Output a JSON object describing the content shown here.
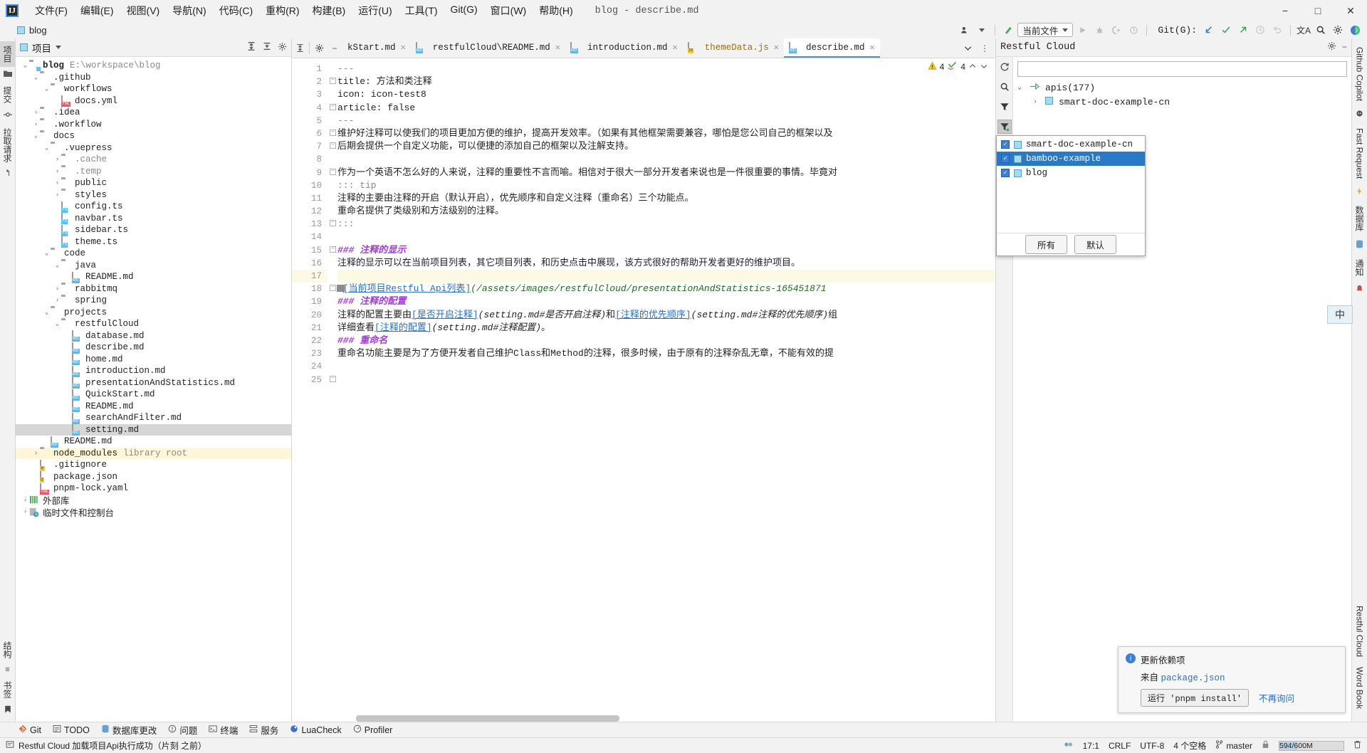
{
  "menubar": {
    "logo": "IJ",
    "items": [
      "文件(F)",
      "编辑(E)",
      "视图(V)",
      "导航(N)",
      "代码(C)",
      "重构(R)",
      "构建(B)",
      "运行(U)",
      "工具(T)",
      "Git(G)",
      "窗口(W)",
      "帮助(H)"
    ],
    "window_title": "blog - describe.md",
    "minimize": "−",
    "maximize": "□",
    "close": "✕"
  },
  "navrow": {
    "breadcrumb": "blog",
    "run_config": "当前文件",
    "git_label": "Git(G):",
    "icons": {
      "vcs_user": "vcs-user-icon",
      "update": "update-icon",
      "run": "▶",
      "debug": "debug-icon",
      "coverage": "coverage-icon",
      "profile": "profile-icon",
      "git_pull": "↙",
      "git_commit": "✓",
      "git_push": "↗",
      "git_history": "◷",
      "git_rollback": "↺",
      "translate": "文A",
      "search": "search-icon",
      "settings": "gear-icon",
      "ai": "ai-icon"
    }
  },
  "left_rail": {
    "items": [
      "项目",
      "提交",
      "拉取请求"
    ],
    "bottom": [
      "结构",
      "书签"
    ]
  },
  "project_panel": {
    "title": "项目",
    "tree": [
      {
        "depth": 0,
        "arrow": "v",
        "icon": "folder-module",
        "label": "blog",
        "bold": true,
        "suffix": "E:\\workspace\\blog"
      },
      {
        "depth": 1,
        "arrow": "v",
        "icon": "folder",
        "label": ".github"
      },
      {
        "depth": 2,
        "arrow": "v",
        "icon": "folder",
        "label": "workflows"
      },
      {
        "depth": 3,
        "arrow": "",
        "icon": "yml",
        "label": "docs.yml"
      },
      {
        "depth": 1,
        "arrow": ">",
        "icon": "folder",
        "label": ".idea"
      },
      {
        "depth": 1,
        "arrow": ">",
        "icon": "folder",
        "label": ".workflow"
      },
      {
        "depth": 1,
        "arrow": "v",
        "icon": "folder",
        "label": "docs"
      },
      {
        "depth": 2,
        "arrow": "v",
        "icon": "folder",
        "label": ".vuepress"
      },
      {
        "depth": 3,
        "arrow": ">",
        "icon": "folder",
        "label": ".cache",
        "dim": true
      },
      {
        "depth": 3,
        "arrow": ">",
        "icon": "folder",
        "label": ".temp",
        "dim": true
      },
      {
        "depth": 3,
        "arrow": ">",
        "icon": "folder",
        "label": "public"
      },
      {
        "depth": 3,
        "arrow": ">",
        "icon": "folder",
        "label": "styles"
      },
      {
        "depth": 3,
        "arrow": "",
        "icon": "ts",
        "label": "config.ts"
      },
      {
        "depth": 3,
        "arrow": "",
        "icon": "ts",
        "label": "navbar.ts"
      },
      {
        "depth": 3,
        "arrow": "",
        "icon": "ts",
        "label": "sidebar.ts"
      },
      {
        "depth": 3,
        "arrow": "",
        "icon": "ts",
        "label": "theme.ts"
      },
      {
        "depth": 2,
        "arrow": "v",
        "icon": "folder",
        "label": "code"
      },
      {
        "depth": 3,
        "arrow": "v",
        "icon": "folder",
        "label": "java"
      },
      {
        "depth": 4,
        "arrow": "",
        "icon": "md",
        "label": "README.md"
      },
      {
        "depth": 3,
        "arrow": ">",
        "icon": "folder",
        "label": "rabbitmq"
      },
      {
        "depth": 3,
        "arrow": ">",
        "icon": "folder",
        "label": "spring"
      },
      {
        "depth": 2,
        "arrow": "v",
        "icon": "folder",
        "label": "projects"
      },
      {
        "depth": 3,
        "arrow": "v",
        "icon": "folder",
        "label": "restfulCloud"
      },
      {
        "depth": 4,
        "arrow": "",
        "icon": "md",
        "label": "database.md"
      },
      {
        "depth": 4,
        "arrow": "",
        "icon": "md",
        "label": "describe.md"
      },
      {
        "depth": 4,
        "arrow": "",
        "icon": "md",
        "label": "home.md"
      },
      {
        "depth": 4,
        "arrow": "",
        "icon": "md",
        "label": "introduction.md"
      },
      {
        "depth": 4,
        "arrow": "",
        "icon": "md",
        "label": "presentationAndStatistics.md"
      },
      {
        "depth": 4,
        "arrow": "",
        "icon": "md",
        "label": "QuickStart.md"
      },
      {
        "depth": 4,
        "arrow": "",
        "icon": "md",
        "label": "README.md"
      },
      {
        "depth": 4,
        "arrow": "",
        "icon": "md",
        "label": "searchAndFilter.md"
      },
      {
        "depth": 4,
        "arrow": "",
        "icon": "md",
        "label": "setting.md",
        "selected": true
      },
      {
        "depth": 2,
        "arrow": "",
        "icon": "md",
        "label": "README.md"
      },
      {
        "depth": 1,
        "arrow": ">",
        "icon": "folder",
        "label": "node_modules",
        "suffix": "library root",
        "highlight": true
      },
      {
        "depth": 1,
        "arrow": "",
        "icon": "gitignore",
        "label": ".gitignore"
      },
      {
        "depth": 1,
        "arrow": "",
        "icon": "json",
        "label": "package.json"
      },
      {
        "depth": 1,
        "arrow": "",
        "icon": "yml",
        "label": "pnpm-lock.yaml"
      },
      {
        "depth": 0,
        "arrow": ">",
        "icon": "lib",
        "label": "外部库"
      },
      {
        "depth": 0,
        "arrow": ">",
        "icon": "scratch",
        "label": "临时文件和控制台"
      }
    ]
  },
  "editor": {
    "tabs": [
      {
        "label": "kStart.md",
        "icon": "md",
        "clipped": true
      },
      {
        "label": "restfulCloud\\README.md",
        "icon": "md"
      },
      {
        "label": "introduction.md",
        "icon": "md"
      },
      {
        "label": "themeData.js",
        "icon": "js",
        "orange": true
      },
      {
        "label": "describe.md",
        "icon": "md",
        "active": true
      }
    ],
    "inspections": {
      "warning_count": "4",
      "typo_count": "4"
    },
    "lines": [
      {
        "n": 1,
        "segs": [
          {
            "t": "---",
            "c": "c-gray"
          }
        ]
      },
      {
        "n": 2,
        "fold": true,
        "segs": [
          {
            "t": "title: 方法和类注释",
            "c": "c-key"
          }
        ]
      },
      {
        "n": 3,
        "segs": [
          {
            "t": "icon: icon-test8",
            "c": "c-key"
          }
        ]
      },
      {
        "n": 4,
        "fold": true,
        "segs": [
          {
            "t": "article: false",
            "c": "c-key"
          }
        ]
      },
      {
        "n": 5,
        "segs": [
          {
            "t": "---",
            "c": "c-gray"
          }
        ]
      },
      {
        "n": 6,
        "fold": true,
        "segs": [
          {
            "t": "维护好注释可以使我们的项目更加方便的维护，提高开发效率。（如果有其他框架需要兼容，哪怕是您公司自己的框架以及",
            "c": "c-key"
          }
        ]
      },
      {
        "n": 7,
        "fold": true,
        "segs": [
          {
            "t": "后期会提供一个自定义功能，可以便捷的添加自己的框架以及注解支持。",
            "c": "c-key"
          }
        ]
      },
      {
        "n": 8,
        "segs": []
      },
      {
        "n": 9,
        "fold": true,
        "segs": [
          {
            "t": "作为一个英语不怎么好的人来说，注释的重要性不言而喻。相信对于很大一部分开发者来说也是一件很重要的事情。毕竟对",
            "c": "c-key"
          }
        ]
      },
      {
        "n": 10,
        "segs": [
          {
            "t": "::: tip",
            "c": "c-gray"
          }
        ]
      },
      {
        "n": 11,
        "segs": [
          {
            "t": "注释的主要由注释的开启（默认开启），优先顺序和自定义注释（重命名）三个功能点。",
            "c": "c-key"
          }
        ]
      },
      {
        "n": 12,
        "segs": [
          {
            "t": "重命名提供了类级别和方法级别的注释。",
            "c": "c-key"
          }
        ]
      },
      {
        "n": 13,
        "fold": true,
        "segs": [
          {
            "t": ":::",
            "c": "c-gray"
          }
        ]
      },
      {
        "n": 14,
        "segs": []
      },
      {
        "n": 15,
        "fold": true,
        "segs": [
          {
            "t": "### ",
            "c": "c-head"
          },
          {
            "t": "注释的显示",
            "c": "c-head"
          }
        ]
      },
      {
        "n": 16,
        "segs": [
          {
            "t": "注释的显示可以在当前项目列表，其它项目列表，和历史点击中展现，该方式很好的帮助开发者更好的维护项目。",
            "c": "c-key"
          }
        ]
      },
      {
        "n": 17,
        "current": true,
        "segs": []
      },
      {
        "n": 18,
        "image": true,
        "fold": true,
        "segs": [
          {
            "t": "!",
            "c": "c-bang"
          },
          {
            "t": "[当前项目Restful Api列表]",
            "c": "c-link"
          },
          {
            "t": "(/assets/images/restfulCloud/presentationAndStatistics-165451871",
            "c": "c-url"
          }
        ]
      },
      {
        "n": 19,
        "segs": [
          {
            "t": "### ",
            "c": "c-head"
          },
          {
            "t": "注释的配置",
            "c": "c-head"
          }
        ]
      },
      {
        "n": 20,
        "segs": [
          {
            "t": "注释的配置主要由",
            "c": "c-key"
          },
          {
            "t": "[是否开启注释]",
            "c": "c-link"
          },
          {
            "t": "(setting.md#是否开启注释)",
            "c": "c-em"
          },
          {
            "t": "和",
            "c": "c-key"
          },
          {
            "t": "[注释的优先顺序]",
            "c": "c-link"
          },
          {
            "t": "(setting.md#注释的优先顺序)",
            "c": "c-em"
          },
          {
            "t": "组",
            "c": "c-key"
          }
        ]
      },
      {
        "n": 21,
        "segs": [
          {
            "t": "详细查看",
            "c": "c-key"
          },
          {
            "t": "[注释的配置]",
            "c": "c-link"
          },
          {
            "t": "(setting.md#注释配置)",
            "c": "c-em"
          },
          {
            "t": "。",
            "c": "c-key"
          }
        ]
      },
      {
        "n": 22,
        "segs": [
          {
            "t": "### ",
            "c": "c-head"
          },
          {
            "t": "重命名",
            "c": "c-head"
          }
        ]
      },
      {
        "n": 23,
        "segs": [
          {
            "t": "重命名功能主要是为了方便开发者自己维护Class和Method的注释，很多时候，由于原有的注释杂乱无章，不能有效的提",
            "c": "c-key"
          }
        ]
      },
      {
        "n": 24,
        "segs": []
      },
      {
        "n": 25,
        "fold": true,
        "segs": []
      }
    ]
  },
  "right_panel": {
    "title": "Restful Cloud",
    "search_placeholder": "",
    "search_value": "",
    "tree": [
      {
        "label": "apis(177)",
        "arrow": "v",
        "icon": "api-root"
      },
      {
        "label": "smart-doc-example-cn",
        "arrow": ">",
        "icon": "module",
        "indent": true
      }
    ],
    "tools": [
      "refresh-icon",
      "search-icon",
      "filter-icon",
      "filter-active-icon"
    ],
    "popup": {
      "items": [
        {
          "label": "smart-doc-example-cn",
          "checked": true,
          "selected": false
        },
        {
          "label": "bamboo-example",
          "checked": true,
          "selected": true
        },
        {
          "label": "blog",
          "checked": true,
          "selected": false
        }
      ],
      "buttons": [
        "所有",
        "默认"
      ]
    }
  },
  "right_rail": {
    "items": [
      "Github Copilot",
      "Fast Request",
      "数据库",
      "通知",
      "Restful Cloud",
      "Word Book"
    ]
  },
  "ime_badge": "中",
  "notification": {
    "title": "更新依赖项",
    "source_prefix": "来自",
    "source": "package.json",
    "action": "运行 'pnpm install'",
    "dismiss": "不再询问"
  },
  "bottom_toolwindows": [
    {
      "label": "Git",
      "icon": "git-icon"
    },
    {
      "label": "TODO",
      "icon": "todo-icon"
    },
    {
      "label": "数据库更改",
      "icon": "db-icon"
    },
    {
      "label": "问题",
      "icon": "problems-icon"
    },
    {
      "label": "终端",
      "icon": "terminal-icon"
    },
    {
      "label": "服务",
      "icon": "services-icon"
    },
    {
      "label": "LuaCheck",
      "icon": "luacheck-icon"
    },
    {
      "label": "Profiler",
      "icon": "profiler-icon"
    }
  ],
  "status_bar": {
    "message": "Restful Cloud 加载项目Api执行成功（片刻 之前）",
    "caret": "17:1",
    "line_sep": "CRLF",
    "encoding": "UTF-8",
    "indent": "4 个空格",
    "branch": "master",
    "memory": "594/600M"
  }
}
